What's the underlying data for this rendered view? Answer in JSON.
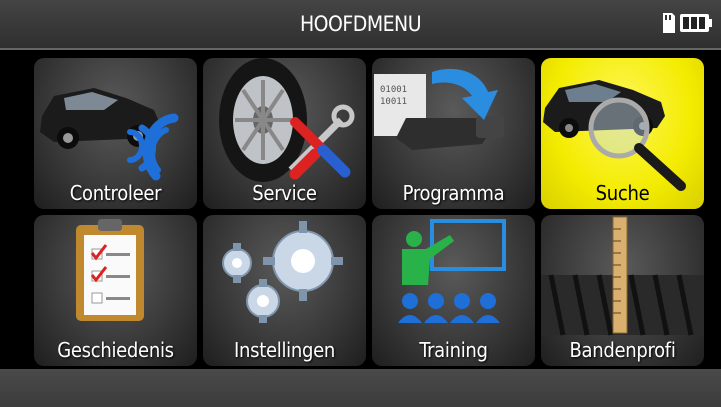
{
  "header": {
    "title": "HOOFDMENU",
    "sd_icon": "sd-card-icon",
    "battery_icon": "battery-icon",
    "battery_level": 1.0
  },
  "menu": {
    "selected_index": 3,
    "items": [
      {
        "label": "Controleer",
        "icon": "car-signal-icon"
      },
      {
        "label": "Service",
        "icon": "tire-tools-icon"
      },
      {
        "label": "Programma",
        "icon": "sensor-program-icon"
      },
      {
        "label": "Suche",
        "icon": "car-magnifier-icon"
      },
      {
        "label": "Geschiedenis",
        "icon": "clipboard-checklist-icon"
      },
      {
        "label": "Instellingen",
        "icon": "gears-icon"
      },
      {
        "label": "Training",
        "icon": "classroom-icon"
      },
      {
        "label": "Bandenprofi",
        "icon": "tread-gauge-icon"
      }
    ]
  },
  "colors": {
    "selected_tile": "#f3ec00",
    "tile": "#3a3a3a",
    "signal_blue": "#1f6fd8"
  }
}
